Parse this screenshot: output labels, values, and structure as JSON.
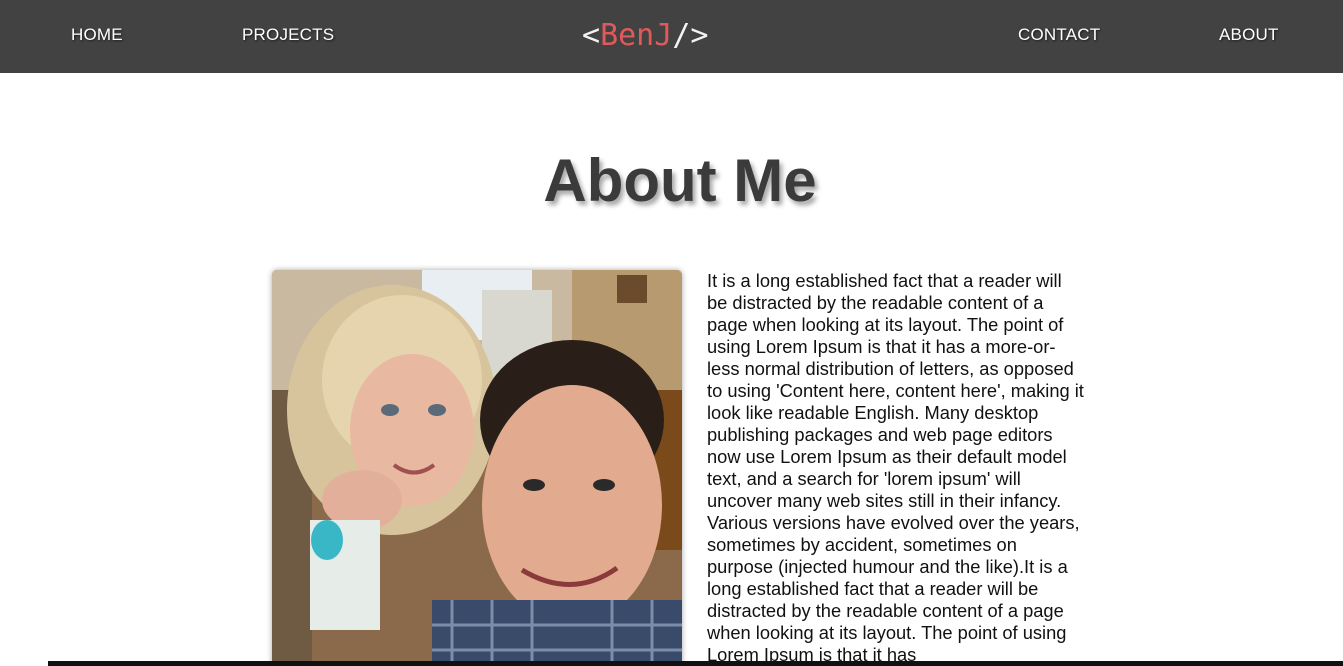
{
  "nav": {
    "home": "HOME",
    "projects": "PROJECTS",
    "contact": "CONTACT",
    "about": "ABOUT"
  },
  "logo": {
    "open": "<",
    "name": "BenJ",
    "close": "/>"
  },
  "page": {
    "title": "About Me"
  },
  "about": {
    "text": "It is a long established fact that a reader will be distracted by the readable content of a page when looking at its layout. The point of using Lorem Ipsum is that it has a more-or-less normal distribution of letters, as opposed to using 'Content here, content here', making it look like readable English. Many desktop publishing packages and web page editors now use Lorem Ipsum as their default model text, and a search for 'lorem ipsum' will uncover many web sites still in their infancy. Various versions have evolved over the years, sometimes by accident, sometimes on purpose (injected humour and the like).It is a long established fact that a reader will be distracted by the readable content of a page when looking at its layout. The point of using Lorem Ipsum is that it has"
  },
  "colors": {
    "navbar": "#424242",
    "logo_accent": "#e05a5a",
    "title": "#3b3b3b"
  }
}
